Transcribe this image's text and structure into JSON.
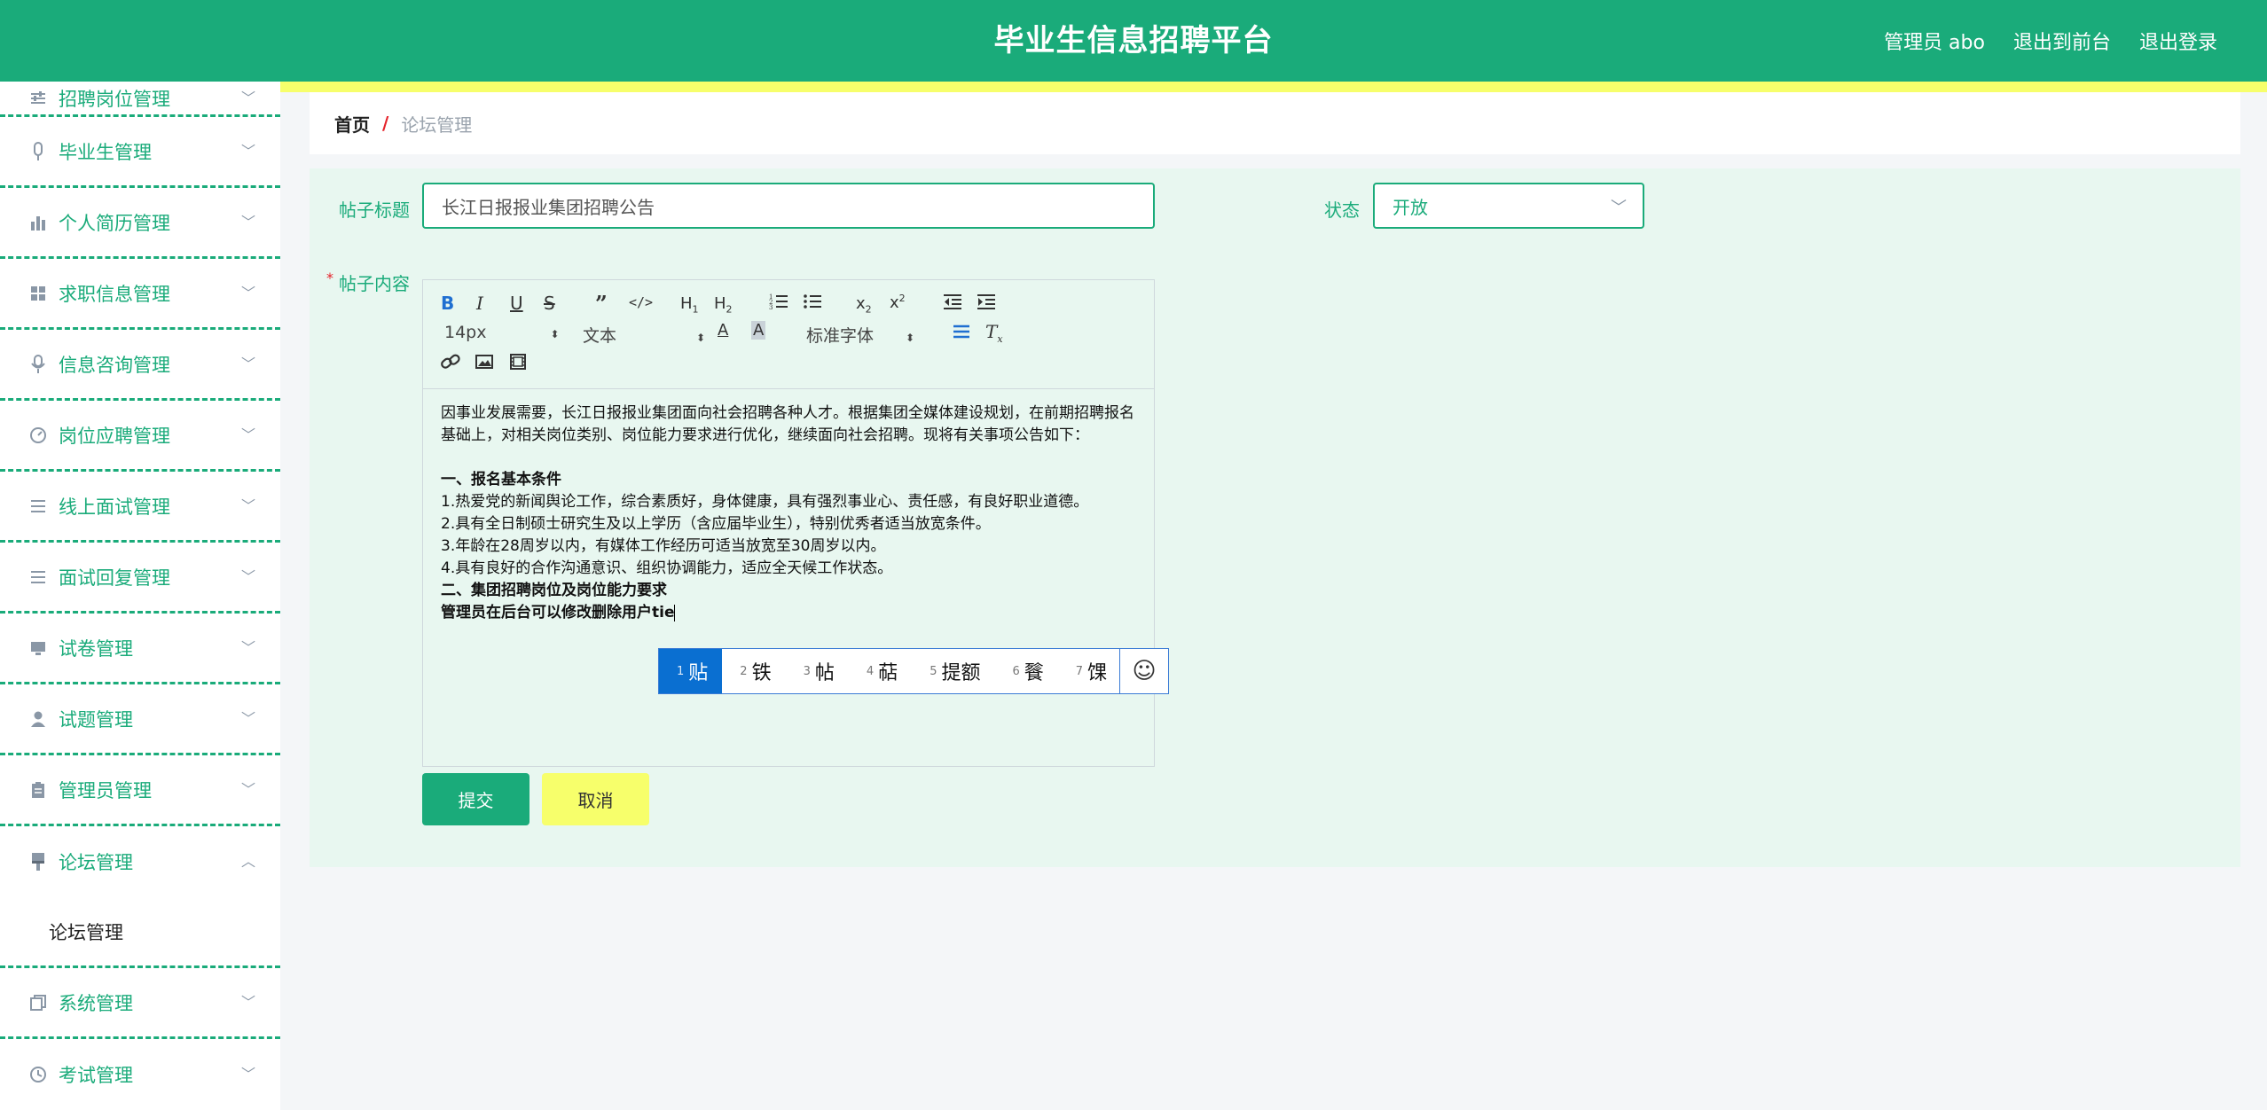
{
  "header": {
    "title": "毕业生信息招聘平台",
    "admin_label": "管理员 abo",
    "front_link": "退出到前台",
    "logout_link": "退出登录"
  },
  "colors": {
    "primary": "#1aab7a",
    "accent_yellow": "#f7ff6b",
    "link_blue": "#1f6fd1"
  },
  "sidebar": {
    "items": [
      {
        "label": "招聘岗位管理",
        "icon": "sliders-icon"
      },
      {
        "label": "毕业生管理",
        "icon": "mic-icon"
      },
      {
        "label": "个人简历管理",
        "icon": "bar-chart-icon"
      },
      {
        "label": "求职信息管理",
        "icon": "grid-icon"
      },
      {
        "label": "信息咨询管理",
        "icon": "microphone-icon"
      },
      {
        "label": "岗位应聘管理",
        "icon": "gauge-icon"
      },
      {
        "label": "线上面试管理",
        "icon": "list-icon"
      },
      {
        "label": "面试回复管理",
        "icon": "list-icon"
      },
      {
        "label": "试卷管理",
        "icon": "monitor-icon"
      },
      {
        "label": "试题管理",
        "icon": "user-icon"
      },
      {
        "label": "管理员管理",
        "icon": "clipboard-icon"
      },
      {
        "label": "论坛管理",
        "icon": "brush-icon",
        "expanded": true
      },
      {
        "label": "系统管理",
        "icon": "copy-icon"
      },
      {
        "label": "考试管理",
        "icon": "clock-icon"
      }
    ],
    "submenu": {
      "label": "论坛管理"
    }
  },
  "breadcrumb": {
    "home": "首页",
    "separator": "/",
    "current": "论坛管理"
  },
  "form": {
    "title_label": "帖子标题",
    "title_value": "长江日报报业集团招聘公告",
    "status_label": "状态",
    "status_value": "开放",
    "content_label": "帖子内容",
    "required_mark": "*",
    "submit_label": "提交",
    "cancel_label": "取消"
  },
  "editor": {
    "toolbar": {
      "font_size": "14px",
      "block_type": "文本",
      "font_family": "标准字体"
    },
    "content": {
      "intro": "因事业发展需要，长江日报报业集团面向社会招聘各种人才。根据集团全媒体建设规划，在前期招聘报名基础上，对相关岗位类别、岗位能力要求进行优化，继续面向社会招聘。现将有关事项公告如下：",
      "section1_title": "一、报名基本条件",
      "conditions": [
        "1.热爱党的新闻舆论工作，综合素质好，身体健康，具有强烈事业心、责任感，有良好职业道德。",
        "2.具有全日制硕士研究生及以上学历（含应届毕业生），特别优秀者适当放宽条件。",
        "3.年龄在28周岁以内，有媒体工作经历可适当放宽至30周岁以内。",
        "4.具有良好的合作沟通意识、组织协调能力，适应全天候工作状态。"
      ],
      "section2_title": "二、集团招聘岗位及岗位能力要求",
      "typing_line": "管理员在后台可以修改删除用户tie"
    }
  },
  "ime": {
    "candidates": [
      {
        "num": "1",
        "text": "贴"
      },
      {
        "num": "2",
        "text": "铁"
      },
      {
        "num": "3",
        "text": "帖"
      },
      {
        "num": "4",
        "text": "萜"
      },
      {
        "num": "5",
        "text": "提额"
      },
      {
        "num": "6",
        "text": "餮"
      },
      {
        "num": "7",
        "text": "馃"
      }
    ],
    "emoji_icon": "☺"
  }
}
